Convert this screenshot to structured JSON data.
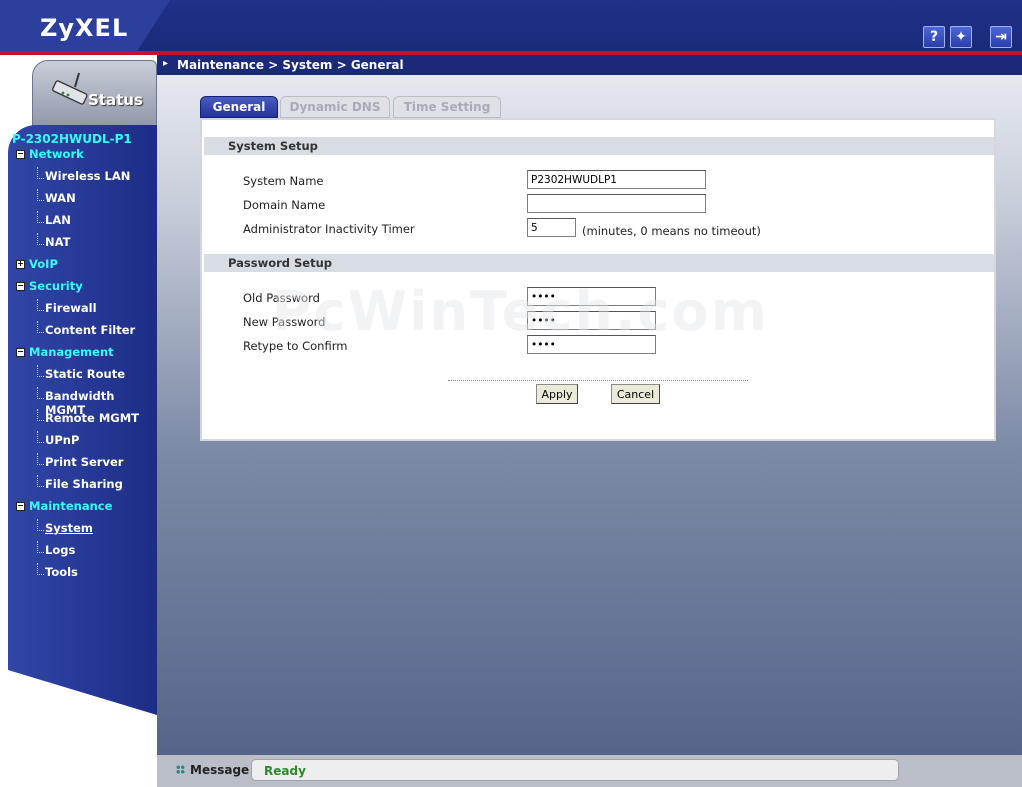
{
  "header": {
    "logo": "ZyXEL",
    "help_label": "?",
    "wizard_label": "✦",
    "logout_label": "⇥"
  },
  "sidebar": {
    "status_label": "Status",
    "device_name": "P-2302HWUDL-P1",
    "items": [
      {
        "label": "Network",
        "level": "top",
        "expander": "−"
      },
      {
        "label": "Wireless LAN",
        "level": "sub"
      },
      {
        "label": "WAN",
        "level": "sub"
      },
      {
        "label": "LAN",
        "level": "sub"
      },
      {
        "label": "NAT",
        "level": "sub"
      },
      {
        "label": "VoIP",
        "level": "top",
        "expander": "+"
      },
      {
        "label": "Security",
        "level": "top",
        "expander": "−"
      },
      {
        "label": "Firewall",
        "level": "sub"
      },
      {
        "label": "Content Filter",
        "level": "sub"
      },
      {
        "label": "Management",
        "level": "top",
        "expander": "−"
      },
      {
        "label": "Static Route",
        "level": "sub"
      },
      {
        "label": "Bandwidth MGMT",
        "level": "sub"
      },
      {
        "label": "Remote MGMT",
        "level": "sub"
      },
      {
        "label": "UPnP",
        "level": "sub"
      },
      {
        "label": "Print Server",
        "level": "sub"
      },
      {
        "label": "File Sharing",
        "level": "sub"
      },
      {
        "label": "Maintenance",
        "level": "top",
        "expander": "−"
      },
      {
        "label": "System",
        "level": "sub",
        "selected": true
      },
      {
        "label": "Logs",
        "level": "sub"
      },
      {
        "label": "Tools",
        "level": "sub"
      }
    ]
  },
  "breadcrumb": {
    "arrow": "▸",
    "text": "Maintenance > System > General"
  },
  "tabs": [
    {
      "label": "General",
      "active": true
    },
    {
      "label": "Dynamic DNS",
      "active": false
    },
    {
      "label": "Time Setting",
      "active": false
    }
  ],
  "system_setup": {
    "title": "System Setup",
    "system_name_label": "System Name",
    "system_name_value": "P2302HWUDLP1",
    "domain_name_label": "Domain Name",
    "domain_name_value": "",
    "timer_label": "Administrator Inactivity Timer",
    "timer_value": "5",
    "timer_hint": "(minutes, 0 means no timeout)"
  },
  "password_setup": {
    "title": "Password Setup",
    "old_label": "Old Password",
    "old_value": "••••",
    "new_label": "New Password",
    "new_value": "••••",
    "retype_label": "Retype to Confirm",
    "retype_value": "••••"
  },
  "buttons": {
    "apply": "Apply",
    "cancel": "Cancel"
  },
  "watermark": "PcWinTech.com",
  "status": {
    "label": "Message",
    "text": "Ready"
  },
  "colors": {
    "accent": "#1a2a78",
    "nav_top": "#33ffff",
    "status_ok": "#2a8a2a",
    "brand_red": "#c8102e"
  }
}
